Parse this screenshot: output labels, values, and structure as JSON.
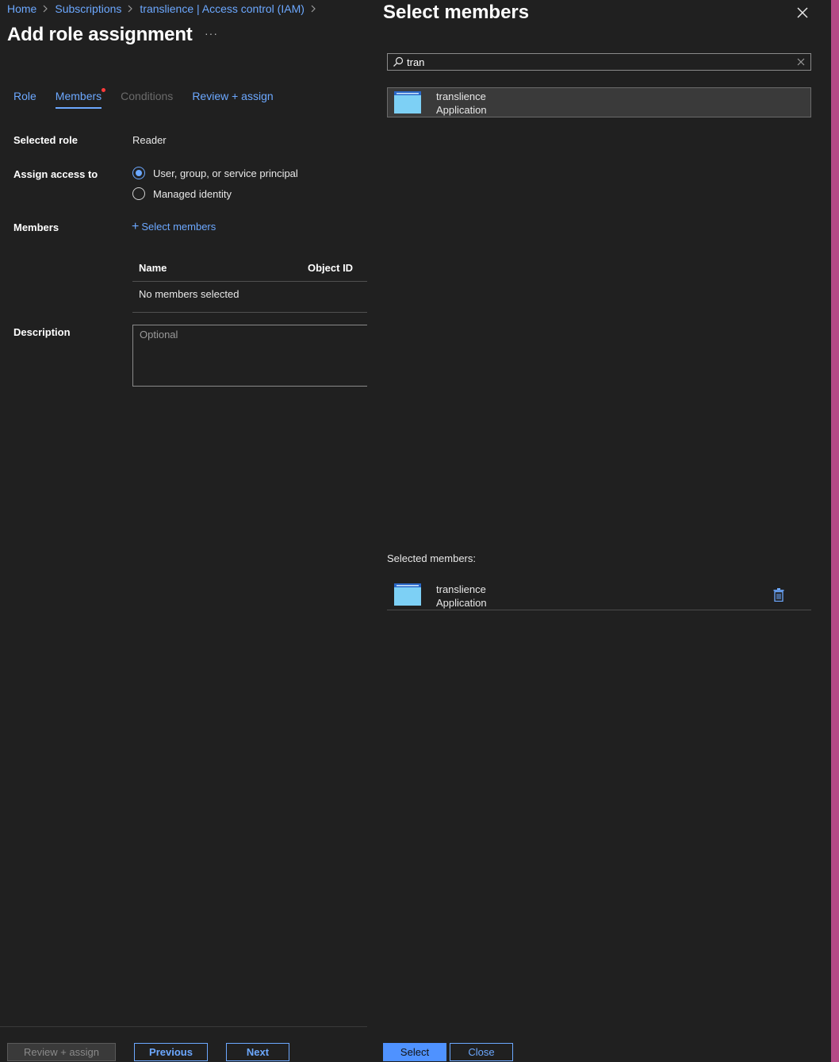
{
  "breadcrumb": {
    "items": [
      "Home",
      "Subscriptions",
      "translience | Access control (IAM)"
    ]
  },
  "page": {
    "title": "Add role assignment",
    "more": "···"
  },
  "tabs": [
    {
      "label": "Role",
      "state": "normal"
    },
    {
      "label": "Members",
      "state": "active"
    },
    {
      "label": "Conditions",
      "state": "disabled"
    },
    {
      "label": "Review + assign",
      "state": "normal"
    }
  ],
  "form": {
    "selected_role_label": "Selected role",
    "selected_role_value": "Reader",
    "assign_access_label": "Assign access to",
    "assign_options": [
      "User, group, or service principal",
      "Managed identity"
    ],
    "assign_selected": 0,
    "members_label": "Members",
    "select_members_link": "Select members",
    "table_headers": [
      "Name",
      "Object ID"
    ],
    "table_empty": "No members selected",
    "description_label": "Description",
    "description_placeholder": "Optional"
  },
  "footer": {
    "review_assign": "Review + assign",
    "previous": "Previous",
    "next": "Next"
  },
  "panel": {
    "title": "Select members",
    "search_value": "tran",
    "results": [
      {
        "name": "translience",
        "type": "Application"
      }
    ],
    "selected_label": "Selected members:",
    "selected": [
      {
        "name": "translience",
        "type": "Application"
      }
    ],
    "select_button": "Select",
    "close_button": "Close"
  },
  "colors": {
    "background": "#202020",
    "accent": "#6ca8ff",
    "primary_button": "#4f92ff",
    "side_edge": "#b44a86"
  },
  "icons": [
    "chevron-right-icon",
    "search-icon",
    "clear-icon",
    "close-icon",
    "app-registration-icon",
    "trash-icon",
    "plus-icon"
  ]
}
